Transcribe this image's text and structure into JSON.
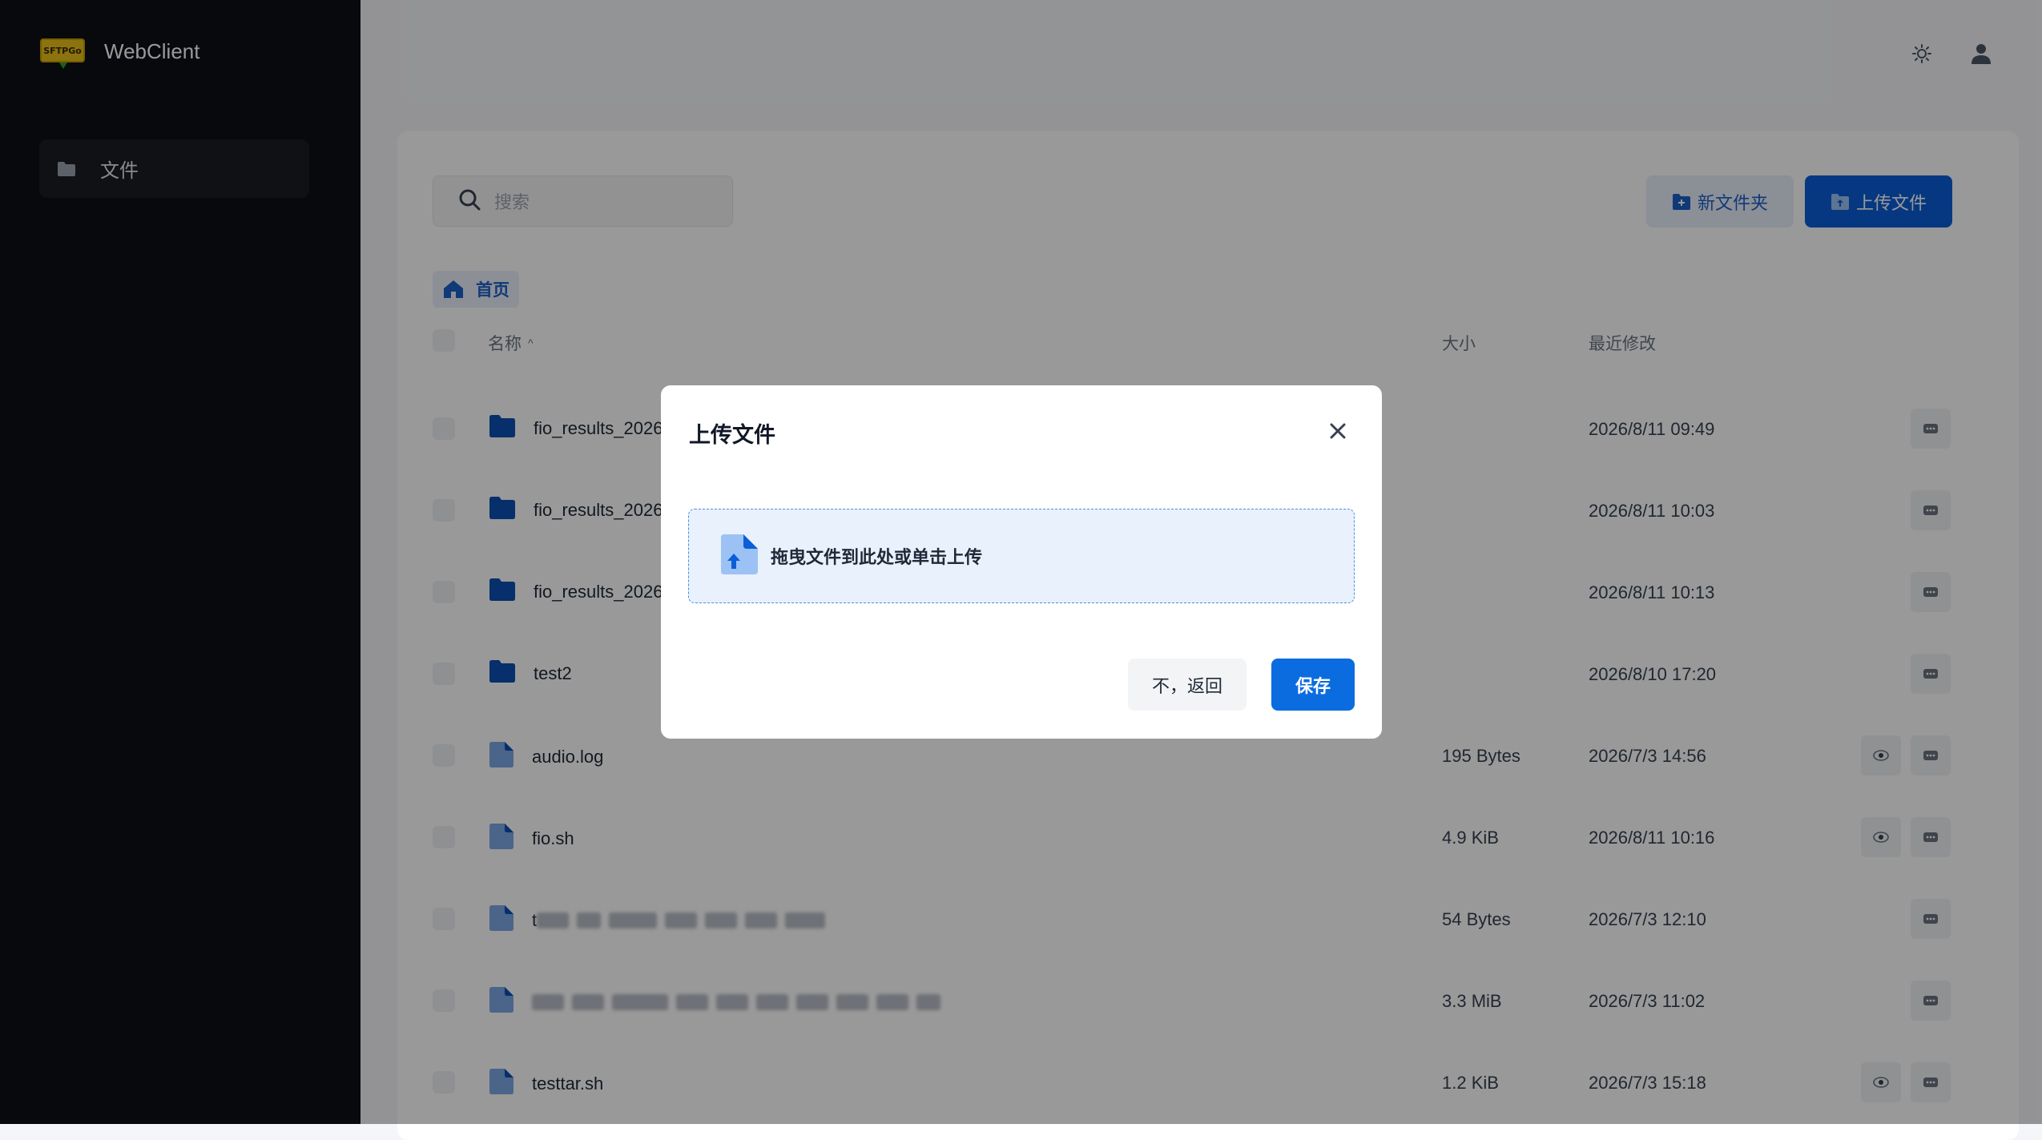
{
  "app": {
    "name": "WebClient",
    "logo_text": "SFTPGo"
  },
  "sidebar": {
    "items": [
      {
        "label": "文件",
        "icon": "folder-icon"
      }
    ]
  },
  "topbar": {
    "icons": [
      "theme-toggle-icon",
      "user-icon"
    ]
  },
  "toolbar": {
    "search_placeholder": "搜索",
    "new_folder_label": "新文件夹",
    "upload_label": "上传文件"
  },
  "breadcrumb": {
    "home_label": "首页"
  },
  "table": {
    "headers": {
      "name": "名称",
      "size": "大小",
      "modified": "最近修改"
    },
    "sort_indicator": "^",
    "rows": [
      {
        "name": "fio_results_2026",
        "type": "folder",
        "size": "",
        "modified": "2026/8/11 09:49",
        "actions": [
          "more"
        ]
      },
      {
        "name": "fio_results_2026",
        "type": "folder",
        "size": "",
        "modified": "2026/8/11 10:03",
        "actions": [
          "more"
        ]
      },
      {
        "name": "fio_results_2026",
        "type": "folder",
        "size": "",
        "modified": "2026/8/11 10:13",
        "actions": [
          "more"
        ]
      },
      {
        "name": "test2",
        "type": "folder",
        "size": "",
        "modified": "2026/8/10 17:20",
        "actions": [
          "more"
        ]
      },
      {
        "name": "audio.log",
        "type": "file",
        "size": "195 Bytes",
        "modified": "2026/7/3 14:56",
        "actions": [
          "view",
          "more"
        ]
      },
      {
        "name": "fio.sh",
        "type": "file",
        "size": "4.9 KiB",
        "modified": "2026/8/11 10:16",
        "actions": [
          "view",
          "more"
        ]
      },
      {
        "name": "t",
        "type": "file",
        "blurred": true,
        "size": "54 Bytes",
        "modified": "2026/7/3 12:10",
        "actions": [
          "more"
        ]
      },
      {
        "name": "",
        "type": "file",
        "blurred": true,
        "size": "3.3 MiB",
        "modified": "2026/7/3 11:02",
        "actions": [
          "more"
        ]
      },
      {
        "name": "testtar.sh",
        "type": "file",
        "size": "1.2 KiB",
        "modified": "2026/7/3 15:18",
        "actions": [
          "view",
          "more"
        ]
      }
    ]
  },
  "modal": {
    "title": "上传文件",
    "dropzone_text": "拖曳文件到此处或单击上传",
    "cancel_label": "不，返回",
    "save_label": "保存"
  },
  "colors": {
    "sidebar_bg": "#0d0f14",
    "primary": "#0b5ed7",
    "folder": "#0b4fb3",
    "file": "#7ea7e6"
  }
}
